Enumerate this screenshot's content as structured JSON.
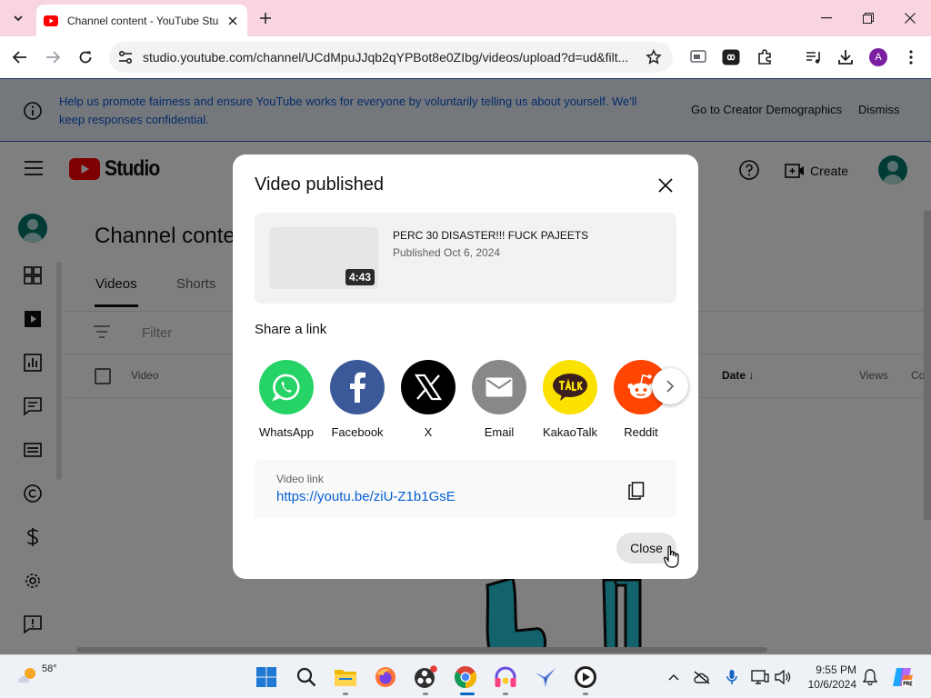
{
  "browser": {
    "tab_title": "Channel content - YouTube Stu",
    "url": "studio.youtube.com/channel/UCdMpuJJqb2qYPBot8e0ZIbg/videos/upload?d=ud&filt...",
    "profile_initial": "A"
  },
  "banner": {
    "text": "Help us promote fairness and ensure YouTube works for everyone by voluntarily telling us about yourself. We'll keep responses confidential.",
    "cta_label": "Go to Creator Demographics",
    "dismiss_label": "Dismiss"
  },
  "studio": {
    "logo_text": "Studio",
    "create_label": "Create",
    "page_title": "Channel content",
    "tabs": [
      "Videos",
      "Shorts"
    ],
    "filter_placeholder": "Filter",
    "columns": {
      "video": "Video",
      "date": "Date",
      "views": "Views",
      "comments": "Co"
    }
  },
  "dialog": {
    "title": "Video published",
    "video": {
      "title": "PERC 30 DISASTER!!! FUCK PAJEETS",
      "published": "Published Oct 6, 2024",
      "duration": "4:43"
    },
    "share_title": "Share a link",
    "share_targets": [
      {
        "label": "WhatsApp",
        "color": "#25d366",
        "icon": "whatsapp-icon"
      },
      {
        "label": "Facebook",
        "color": "#3b5998",
        "icon": "facebook-icon"
      },
      {
        "label": "X",
        "color": "#000000",
        "icon": "x-icon"
      },
      {
        "label": "Email",
        "color": "#888888",
        "icon": "email-icon"
      },
      {
        "label": "KakaoTalk",
        "color": "#fae100",
        "icon": "kakaotalk-icon"
      },
      {
        "label": "Reddit",
        "color": "#ff4500",
        "icon": "reddit-icon"
      }
    ],
    "link_label": "Video link",
    "link_url": "https://youtu.be/ziU-Z1b1GsE",
    "close_label": "Close"
  },
  "taskbar": {
    "temperature": "58°",
    "time": "9:55 PM",
    "date": "10/6/2024"
  },
  "colors": {
    "youtube_red": "#ff0000",
    "link_blue": "#065fd4",
    "banner_text": "#0b57d0"
  }
}
